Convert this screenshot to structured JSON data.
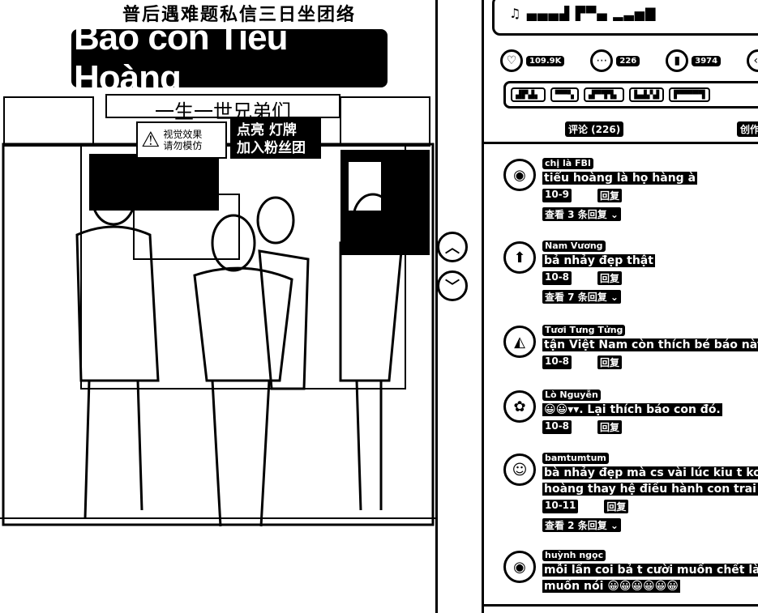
{
  "video": {
    "overlay_top": "普后遇难题私信三日坐团络",
    "overlay_title": "Báo con Tiểu Hoàng",
    "overlay_sub": "一生一世兄弟们",
    "warning": "视觉效果\n请勿模仿",
    "live_badge": "点亮 灯牌\n加入粉丝团",
    "warning_icon": "warning-triangle-icon"
  },
  "nav": {
    "up_icon": "chevron-up-icon",
    "down_icon": "chevron-down-icon"
  },
  "panel": {
    "author_line": "♫ ▄▄▄▟ ▛▀▄ ▂▃▅▇",
    "stats": {
      "likes": "109.9K",
      "comments": "226",
      "favorites": "3974"
    },
    "tags": [
      "▟▛▟▖",
      "▀▀▚",
      "▟▀▜▜▖",
      "▙▟▞▟",
      "▛▀▀▀▜"
    ],
    "tab_comments": "评论 (226)",
    "tab_creator": "创作"
  },
  "comments": [
    {
      "name": "chị là FBI",
      "text": "tiểu hoàng là họ hàng à",
      "date": "10-9",
      "reply": "回复",
      "more": "查看 3 条回复",
      "avatar": "user-avatar-icon"
    },
    {
      "name": "Nam Vương",
      "text": "bả nhảy đẹp thật",
      "date": "10-8",
      "reply": "回复",
      "more": "查看 7 条回复",
      "avatar": "user-avatar-icon"
    },
    {
      "name": "Tươi Tưng Tửng",
      "text": "tận Việt Nam còn thích bé báo này",
      "date": "10-8",
      "reply": "回复",
      "more": "",
      "avatar": "user-avatar-icon"
    },
    {
      "name": "Lò Nguyễn",
      "text": "😀😀▾▾. Lại thích báo con đó.",
      "date": "10-8",
      "reply": "回复",
      "more": "",
      "avatar": "user-avatar-icon"
    },
    {
      "name": "bamtumtum",
      "text": "bà nhảy đẹp mà cs vài lúc kiu t ko bik ns",
      "text2": "hoàng thay hệ điều hành con trai rồi",
      "date": "10-11",
      "reply": "回复",
      "more": "查看 2 条回复",
      "avatar": "smiley-icon"
    },
    {
      "name": "huỳnh ngọc",
      "text": "mỗi lần coi bả t cười muốn chết làm nhiều",
      "text2": "muốn nói 😀😀😀😀😀😀",
      "date": "",
      "reply": "",
      "more": "",
      "avatar": "user-avatar-icon"
    }
  ]
}
